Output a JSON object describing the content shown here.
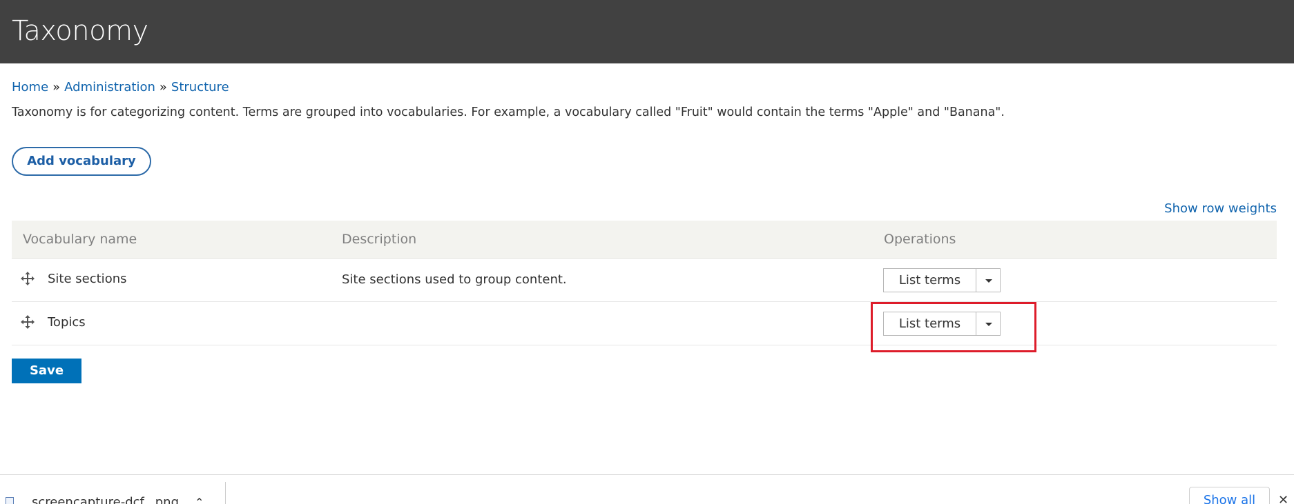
{
  "header": {
    "title": "Taxonomy"
  },
  "breadcrumb": {
    "items": [
      "Home",
      "Administration",
      "Structure"
    ],
    "separator": "»"
  },
  "intro": "Taxonomy is for categorizing content. Terms are grouped into vocabularies. For example, a vocabulary called \"Fruit\" would contain the terms \"Apple\" and \"Banana\".",
  "actions": {
    "add_vocabulary": "Add vocabulary",
    "show_row_weights": "Show row weights",
    "save": "Save"
  },
  "table": {
    "columns": [
      "Vocabulary name",
      "Description",
      "Operations"
    ],
    "rows": [
      {
        "name": "Site sections",
        "description": "Site sections used to group content.",
        "operation": "List terms"
      },
      {
        "name": "Topics",
        "description": "",
        "operation": "List terms"
      }
    ]
  },
  "download_bar": {
    "file_name": "screencapture-dcf...png",
    "show_all": "Show all"
  },
  "colors": {
    "header_bg": "#414141",
    "link": "#0f63ad",
    "primary_button": "#0071b8",
    "highlight": "#dd1c2a"
  },
  "icons": {
    "drag_handle": "move-arrows-icon",
    "dropdown": "caret-down-icon",
    "file": "file-icon",
    "chevron": "chevron-up-icon",
    "close": "close-icon"
  }
}
